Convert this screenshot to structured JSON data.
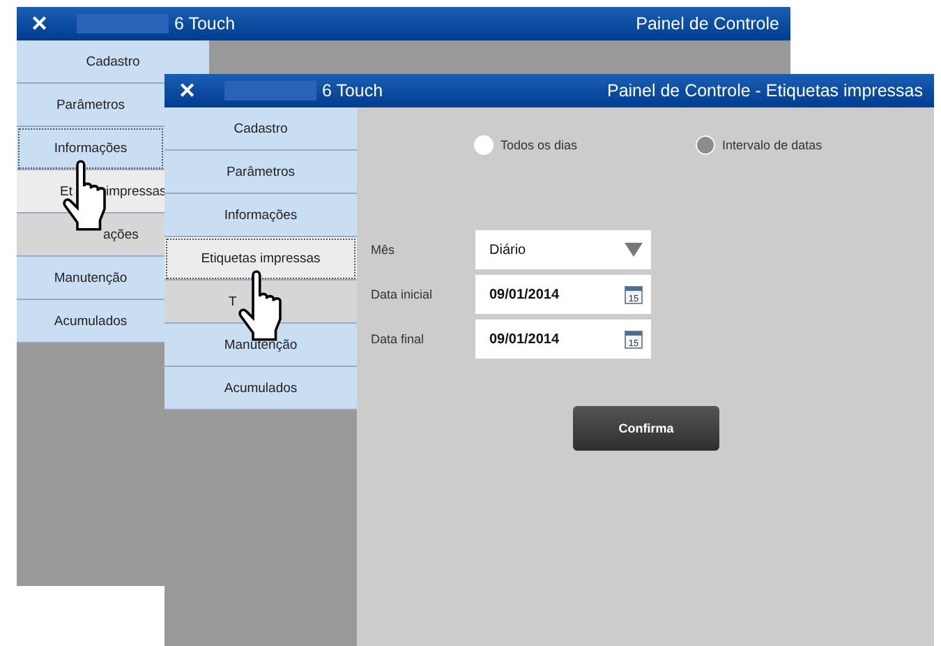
{
  "windows": [
    {
      "app_name": "6 Touch",
      "title": "Painel de Controle",
      "close": "✕",
      "pointer_visible": true,
      "menu": [
        {
          "label": "Cadastro",
          "selected": false,
          "highlighted": false,
          "pressed": false
        },
        {
          "label": "Parâmetros",
          "selected": false,
          "highlighted": false,
          "pressed": false
        },
        {
          "label": "Informações",
          "selected": true,
          "highlighted": false,
          "pressed": false
        },
        {
          "label": "Et",
          "label_tail": "impressas",
          "selected": false,
          "highlighted": true,
          "pressed": false
        },
        {
          "label": "ações",
          "covered": true,
          "selected": false,
          "highlighted": false,
          "pressed": true
        },
        {
          "label": "Manutenção",
          "selected": false,
          "highlighted": false,
          "pressed": false
        },
        {
          "label": "Acumulados",
          "selected": false,
          "highlighted": false,
          "pressed": false
        }
      ]
    },
    {
      "app_name": "6 Touch",
      "title": "Painel de Controle - Etiquetas impressas",
      "close": "✕",
      "pointer_visible": true,
      "menu": [
        {
          "label": "Cadastro",
          "selected": false,
          "highlighted": false,
          "pressed": false
        },
        {
          "label": "Parâmetros",
          "selected": false,
          "highlighted": false,
          "pressed": false
        },
        {
          "label": "Informações",
          "selected": false,
          "highlighted": false,
          "pressed": false
        },
        {
          "label": "Etiquetas impressas",
          "selected": true,
          "highlighted": true,
          "pressed": false
        },
        {
          "label": "T",
          "covered": true,
          "selected": false,
          "highlighted": false,
          "pressed": true
        },
        {
          "label": "Manutenção",
          "selected": false,
          "highlighted": false,
          "pressed": false
        },
        {
          "label": "Acumulados",
          "selected": false,
          "highlighted": false,
          "pressed": false
        }
      ],
      "form": {
        "radios": [
          {
            "label": "Todos os dias",
            "selected": false
          },
          {
            "label": "Intervalo de datas",
            "selected": true
          }
        ],
        "fields": [
          {
            "kind": "select",
            "label": "Mês",
            "value": "Diário"
          },
          {
            "kind": "date",
            "label": "Data inicial",
            "value": "09/01/2014",
            "calendar_day": "15"
          },
          {
            "kind": "date",
            "label": "Data final",
            "value": "09/01/2014",
            "calendar_day": "15"
          }
        ],
        "button": "Confirma"
      }
    }
  ]
}
